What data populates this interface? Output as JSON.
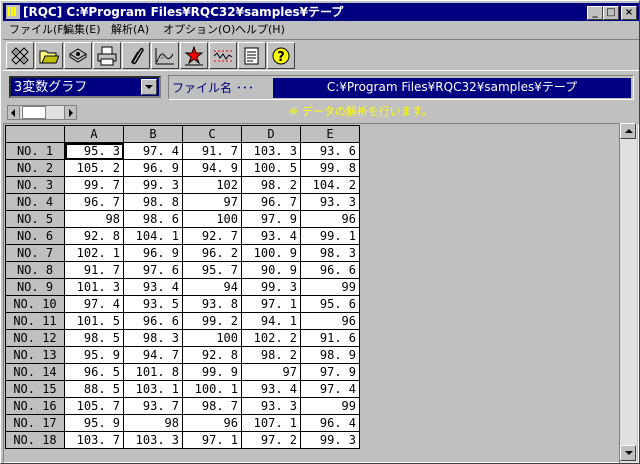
{
  "window": {
    "title": "[RQC] C:¥Program Files¥RQC32¥samples¥テープ",
    "controls": {
      "minimize": "_",
      "maximize": "□",
      "close": "×"
    }
  },
  "menu": [
    "ファイル(F)",
    "編集(E)",
    "解析(A)",
    "オプション(O)",
    "ヘルプ(H)"
  ],
  "toolbar": [
    "grid-pattern-icon",
    "open-folder-icon",
    "disk-icon",
    "printer-icon",
    "paperclip-icon",
    "histogram-icon",
    "scatter-star-icon",
    "control-chart-icon",
    "report-icon",
    "help-question-icon"
  ],
  "selector": {
    "graph_type": "3変数グラフ",
    "filename_label": "ファイル名 ･･･",
    "filename_value": "C:¥Program Files¥RQC32¥samples¥テープ"
  },
  "status": {
    "text": "※ データの解析を行います。"
  },
  "colors": {
    "title_bar": "#000080",
    "status_text": "#ffff00",
    "face": "#c0c0c0"
  },
  "table": {
    "columns": [
      "A",
      "B",
      "C",
      "D",
      "E"
    ],
    "rows": [
      {
        "label": "NO. 1",
        "values": [
          "95. 3",
          "97. 4",
          "91. 7",
          "103. 3",
          "93. 6"
        ]
      },
      {
        "label": "NO. 2",
        "values": [
          "105. 2",
          "96. 9",
          "94. 9",
          "100. 5",
          "99. 8"
        ]
      },
      {
        "label": "NO. 3",
        "values": [
          "99. 7",
          "99. 3",
          "102",
          "98. 2",
          "104. 2"
        ]
      },
      {
        "label": "NO. 4",
        "values": [
          "96. 7",
          "98. 8",
          "97",
          "96. 7",
          "93. 3"
        ]
      },
      {
        "label": "NO. 5",
        "values": [
          "98",
          "98. 6",
          "100",
          "97. 9",
          "96"
        ]
      },
      {
        "label": "NO. 6",
        "values": [
          "92. 8",
          "104. 1",
          "92. 7",
          "93. 4",
          "99. 1"
        ]
      },
      {
        "label": "NO. 7",
        "values": [
          "102. 1",
          "96. 9",
          "96. 2",
          "100. 9",
          "98. 3"
        ]
      },
      {
        "label": "NO. 8",
        "values": [
          "91. 7",
          "97. 6",
          "95. 7",
          "90. 9",
          "96. 6"
        ]
      },
      {
        "label": "NO. 9",
        "values": [
          "101. 3",
          "93. 4",
          "94",
          "99. 3",
          "99"
        ]
      },
      {
        "label": "NO. 10",
        "values": [
          "97. 4",
          "93. 5",
          "93. 8",
          "97. 1",
          "95. 6"
        ]
      },
      {
        "label": "NO. 11",
        "values": [
          "101. 5",
          "96. 6",
          "99. 2",
          "94. 1",
          "96"
        ]
      },
      {
        "label": "NO. 12",
        "values": [
          "98. 5",
          "98. 3",
          "100",
          "102. 2",
          "91. 6"
        ]
      },
      {
        "label": "NO. 13",
        "values": [
          "95. 9",
          "94. 7",
          "92. 8",
          "98. 2",
          "98. 9"
        ]
      },
      {
        "label": "NO. 14",
        "values": [
          "96. 5",
          "101. 8",
          "99. 9",
          "97",
          "97. 9"
        ]
      },
      {
        "label": "NO. 15",
        "values": [
          "88. 5",
          "103. 1",
          "100. 1",
          "93. 4",
          "97. 4"
        ]
      },
      {
        "label": "NO. 16",
        "values": [
          "105. 7",
          "93. 7",
          "98. 7",
          "93. 3",
          "99"
        ]
      },
      {
        "label": "NO. 17",
        "values": [
          "95. 9",
          "98",
          "96",
          "107. 1",
          "96. 4"
        ]
      },
      {
        "label": "NO. 18",
        "values": [
          "103. 7",
          "103. 3",
          "97. 1",
          "97. 2",
          "99. 3"
        ]
      }
    ]
  }
}
